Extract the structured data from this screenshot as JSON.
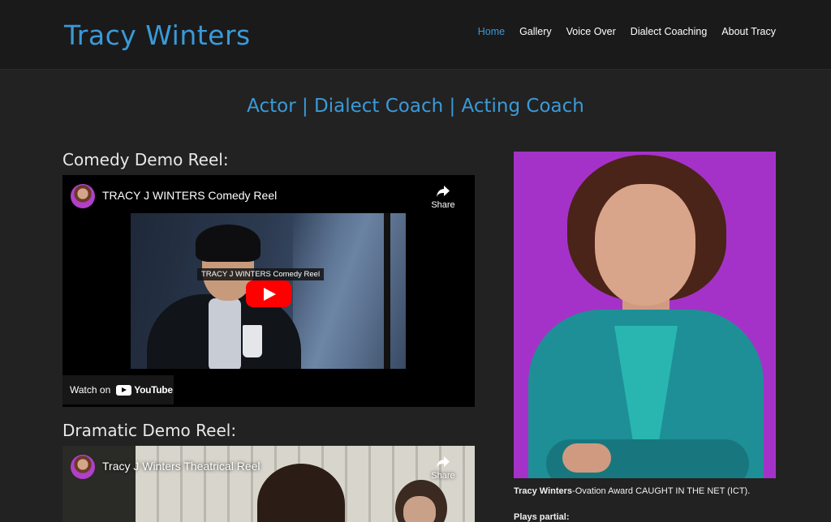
{
  "header": {
    "site_title": "Tracy Winters",
    "nav": [
      {
        "label": "Home",
        "active": true
      },
      {
        "label": "Gallery",
        "active": false
      },
      {
        "label": "Voice Over",
        "active": false
      },
      {
        "label": "Dialect Coaching",
        "active": false
      },
      {
        "label": "About Tracy",
        "active": false
      }
    ]
  },
  "tagline": "Actor | Dialect Coach | Acting Coach",
  "comedy": {
    "heading": "Comedy Demo Reel:",
    "video_title": "TRACY J WINTERS Comedy Reel",
    "thumbnail_caption": "TRACY J WINTERS Comedy Reel",
    "share_label": "Share",
    "watch_on_label": "Watch on",
    "youtube_label": "YouTube"
  },
  "drama": {
    "heading": "Dramatic Demo Reel:",
    "video_title": "Tracy J Winters Theatrical Reel",
    "share_label": "Share"
  },
  "bio": {
    "name": "Tracy Winters",
    "text": "-Ovation Award CAUGHT IN THE NET (ICT).",
    "plays_heading": "Plays partial:"
  },
  "colors": {
    "accent": "#3a9ad9",
    "header_bg": "#1a1a1a",
    "page_bg": "#222222",
    "portrait_bg": "#a532c8",
    "youtube_red": "#ff0000"
  },
  "icons": {
    "share": "share-arrow-icon",
    "play": "play-icon",
    "youtube": "youtube-logo-icon"
  }
}
